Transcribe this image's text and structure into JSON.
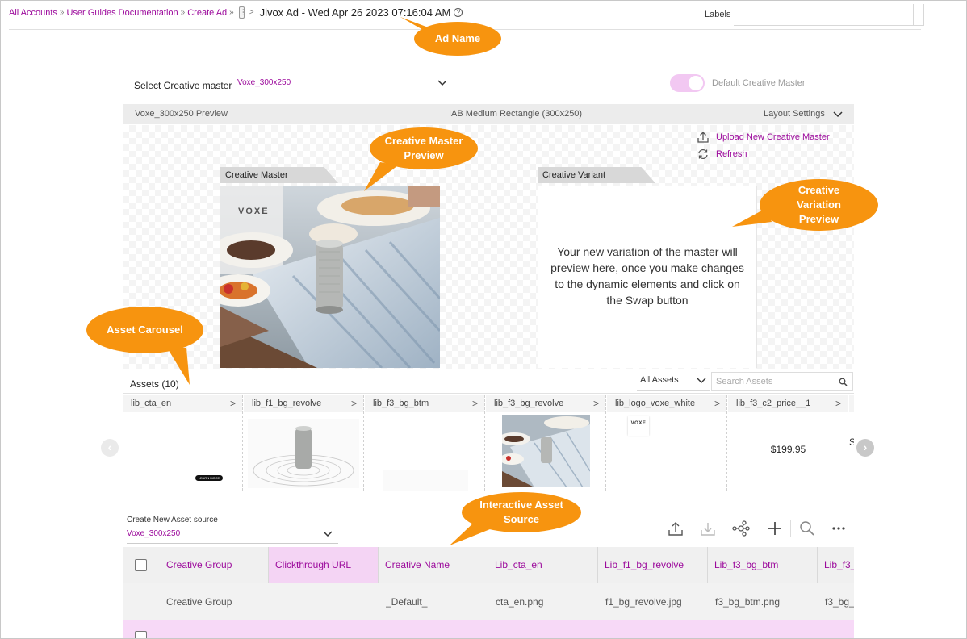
{
  "breadcrumb": {
    "items": [
      "All Accounts",
      "User Guides Documentation",
      "Create Ad"
    ],
    "ad_name": "Jivox Ad - Wed Apr 26 2023 07:16:04 AM"
  },
  "labels": {
    "label": "Labels"
  },
  "callouts": {
    "ad_name": "Ad Name",
    "creative_master_preview": "Creative Master Preview",
    "creative_variation_preview": "Creative Variation Preview",
    "asset_carousel": "Asset Carousel",
    "interactive_asset_source": "Interactive Asset Source"
  },
  "creative_master": {
    "select_label": "Select Creative master",
    "selected": "Voxe_300x250",
    "default_label": "Default Creative Master",
    "default_on": true
  },
  "preview_bar": {
    "left": "Voxe_300x250 Preview",
    "center": "IAB Medium Rectangle (300x250)",
    "right": "Layout Settings"
  },
  "preview": {
    "upload_label": "Upload New Creative Master",
    "refresh_label": "Refresh",
    "master_tab": "Creative Master",
    "variant_tab": "Creative Variant",
    "variant_message": "Your new variation of the master will preview here, once you make changes to the dynamic elements and click on the Swap button",
    "brand_logo": "VOXE"
  },
  "assets": {
    "title": "Assets (10)",
    "filter": "All Assets",
    "search_placeholder": "Search Assets",
    "items": [
      {
        "name": "lib_cta_en",
        "cta_text": "LEARN MORE"
      },
      {
        "name": "lib_f1_bg_revolve"
      },
      {
        "name": "lib_f3_bg_btm"
      },
      {
        "name": "lib_f3_bg_revolve"
      },
      {
        "name": "lib_logo_voxe_white",
        "logo_text": "VOXE"
      },
      {
        "name": "lib_f3_c2_price__1",
        "price": "$199.95"
      },
      {
        "name": "",
        "partial": "S"
      }
    ]
  },
  "asset_source": {
    "label": "Create New Asset source",
    "selected": "Voxe_300x250",
    "columns": [
      "Creative Group",
      "Clickthrough URL",
      "Creative Name",
      "Lib_cta_en",
      "Lib_f1_bg_revolve",
      "Lib_f3_bg_btm",
      "Lib_f3_"
    ],
    "row": [
      "Creative Group",
      "",
      "_Default_",
      "cta_en.png",
      "f1_bg_revolve.jpg",
      "f3_bg_btm.png",
      "f3_bg_"
    ]
  },
  "colors": {
    "accent": "#9c0a9c",
    "callout": "#f7940f",
    "toggle": "#f2c8f2"
  }
}
